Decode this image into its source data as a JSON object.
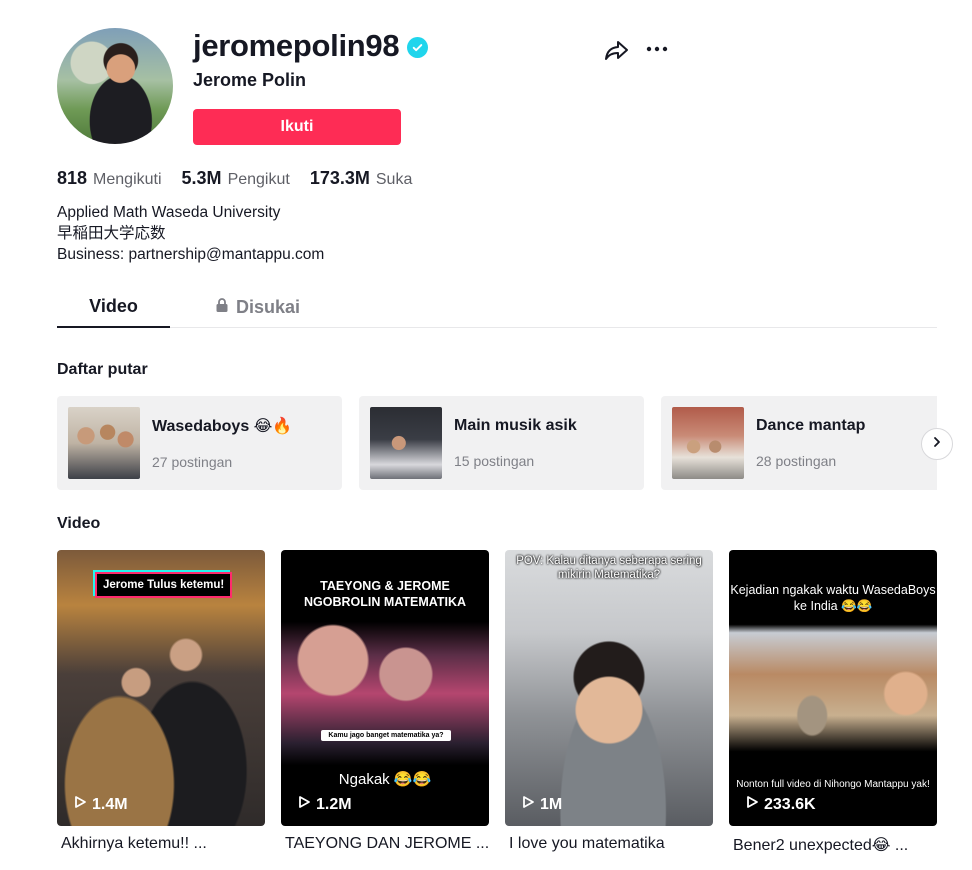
{
  "profile": {
    "username": "jeromepolin98",
    "nickname": "Jerome Polin",
    "follow_label": "Ikuti",
    "verified_color": "#20d5ec",
    "accent_color": "#fe2c55"
  },
  "stats": [
    {
      "value": "818",
      "label": "Mengikuti"
    },
    {
      "value": "5.3M",
      "label": "Pengikut"
    },
    {
      "value": "173.3M",
      "label": "Suka"
    }
  ],
  "bio": [
    "Applied Math Waseda University",
    "早稲田大学応数",
    "Business: partnership@mantappu.com"
  ],
  "tabs": [
    {
      "label": "Video",
      "active": true
    },
    {
      "label": "Disukai",
      "active": false,
      "icon": "lock-icon"
    }
  ],
  "playlists_section": {
    "title": "Daftar putar",
    "items": [
      {
        "title": "Wasedaboys 😂🔥",
        "count": "27 postingan"
      },
      {
        "title": "Main musik asik",
        "count": "15 postingan"
      },
      {
        "title": "Dance mantap",
        "count": "28 postingan"
      }
    ]
  },
  "videos_section": {
    "title": "Video",
    "items": [
      {
        "views": "1.4M",
        "title": "Akhirnya ketemu!! ...",
        "overlay": "Jerome Tulus ketemu!"
      },
      {
        "views": "1.2M",
        "title": "TAEYONG DAN JEROME ...",
        "overlay": "TAEYONG & JEROME NGOBROLIN MATEMATIKA",
        "overlay_mid": "Kamu jago banget matematika ya?",
        "overlay_bottom": "Ngakak 😂😂"
      },
      {
        "views": "1M",
        "title": "I love you matematika",
        "overlay": "POV: Kalau ditanya seberapa sering mikirin Matematika?"
      },
      {
        "views": "233.6K",
        "title": "Bener2 unexpected😂 ...",
        "overlay": "Kejadian ngakak waktu WasedaBoys ke India 😂😂",
        "overlay_bottom": "Nonton full video di Nihongo Mantappu yak!"
      }
    ]
  }
}
